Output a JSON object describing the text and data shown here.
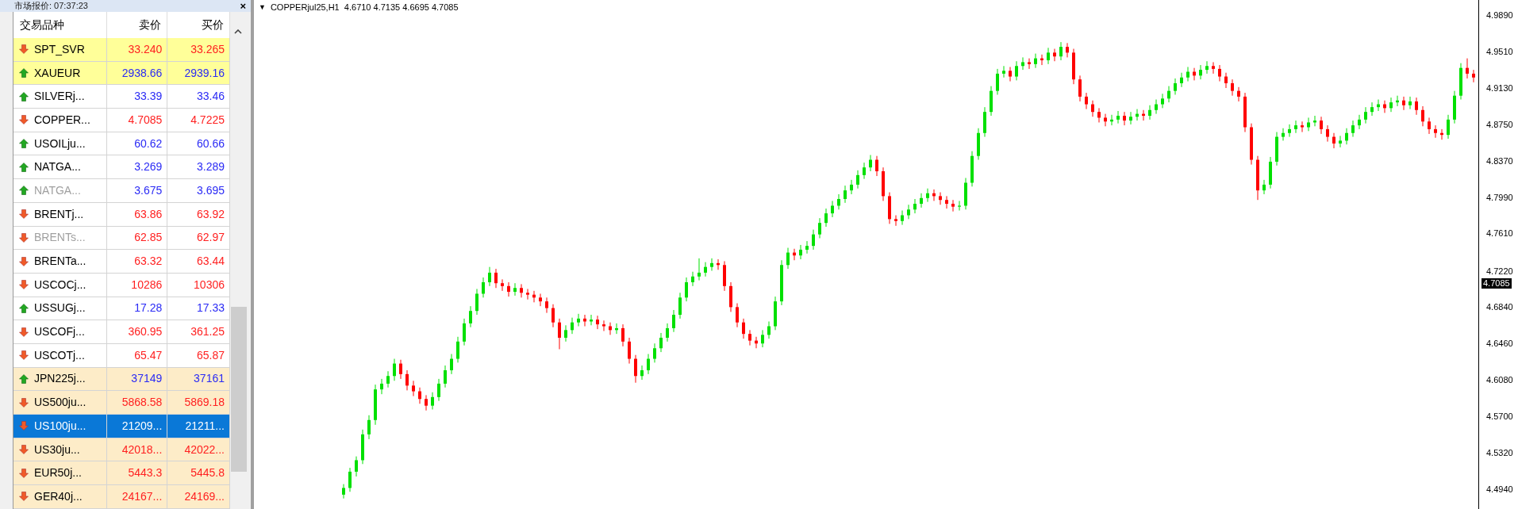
{
  "market_watch": {
    "title": "市场报价: 07:37:23",
    "close_icon": "×",
    "columns": [
      "交易品种",
      "卖价",
      "买价"
    ],
    "rows": [
      {
        "symbol": "SPT_SVR",
        "bid": "33.240",
        "ask": "33.265",
        "rising": false,
        "kind": "spot",
        "disabled": false,
        "selected": false
      },
      {
        "symbol": "XAUEUR",
        "bid": "2938.66",
        "ask": "2939.16",
        "rising": true,
        "kind": "spot",
        "disabled": false,
        "selected": false
      },
      {
        "symbol": "SILVERj...",
        "bid": "33.39",
        "ask": "33.46",
        "rising": true,
        "kind": "futures",
        "disabled": false,
        "selected": false
      },
      {
        "symbol": "COPPER...",
        "bid": "4.7085",
        "ask": "4.7225",
        "rising": false,
        "kind": "futures",
        "disabled": false,
        "selected": false
      },
      {
        "symbol": "USOILju...",
        "bid": "60.62",
        "ask": "60.66",
        "rising": true,
        "kind": "futures",
        "disabled": false,
        "selected": false
      },
      {
        "symbol": "NATGA...",
        "bid": "3.269",
        "ask": "3.289",
        "rising": true,
        "kind": "futures",
        "disabled": false,
        "selected": false
      },
      {
        "symbol": "NATGA...",
        "bid": "3.675",
        "ask": "3.695",
        "rising": true,
        "kind": "futures",
        "disabled": true,
        "selected": false
      },
      {
        "symbol": "BRENTj...",
        "bid": "63.86",
        "ask": "63.92",
        "rising": false,
        "kind": "futures",
        "disabled": false,
        "selected": false
      },
      {
        "symbol": "BRENTs...",
        "bid": "62.85",
        "ask": "62.97",
        "rising": false,
        "kind": "futures",
        "disabled": true,
        "selected": false
      },
      {
        "symbol": "BRENTa...",
        "bid": "63.32",
        "ask": "63.44",
        "rising": false,
        "kind": "futures",
        "disabled": false,
        "selected": false
      },
      {
        "symbol": "USCOCj...",
        "bid": "10286",
        "ask": "10306",
        "rising": false,
        "kind": "futures",
        "disabled": false,
        "selected": false
      },
      {
        "symbol": "USSUGj...",
        "bid": "17.28",
        "ask": "17.33",
        "rising": true,
        "kind": "futures",
        "disabled": false,
        "selected": false
      },
      {
        "symbol": "USCOFj...",
        "bid": "360.95",
        "ask": "361.25",
        "rising": false,
        "kind": "futures",
        "disabled": false,
        "selected": false
      },
      {
        "symbol": "USCOTj...",
        "bid": "65.47",
        "ask": "65.87",
        "rising": false,
        "kind": "futures",
        "disabled": false,
        "selected": false
      },
      {
        "symbol": "JPN225j...",
        "bid": "37149",
        "ask": "37161",
        "rising": true,
        "kind": "index",
        "disabled": false,
        "selected": false
      },
      {
        "symbol": "US500ju...",
        "bid": "5868.58",
        "ask": "5869.18",
        "rising": false,
        "kind": "index",
        "disabled": false,
        "selected": false
      },
      {
        "symbol": "US100ju...",
        "bid": "21209...",
        "ask": "21211...",
        "rising": false,
        "selected": true
      },
      {
        "symbol": "US30ju...",
        "bid": "42018...",
        "ask": "42022...",
        "rising": false,
        "kind": "index",
        "disabled": false,
        "selected": false
      },
      {
        "symbol": "EUR50j...",
        "bid": "5443.3",
        "ask": "5445.8",
        "rising": false,
        "kind": "index",
        "disabled": false,
        "selected": false
      },
      {
        "symbol": "GER40j...",
        "bid": "24167...",
        "ask": "24169...",
        "rising": false,
        "kind": "index",
        "disabled": false,
        "selected": false
      }
    ]
  },
  "chart": {
    "collapse_glyph": "▼",
    "header": "COPPERjul25,H1  4.6710 4.7135 4.6695 4.7085",
    "current_price": "4.7085",
    "chart_data": {
      "type": "candlestick",
      "ylim": [
        4.473,
        5.005
      ],
      "yticks": [
        {
          "value": 4.989,
          "label": "4.9890"
        },
        {
          "value": 4.951,
          "label": "4.9510"
        },
        {
          "value": 4.913,
          "label": "4.9130"
        },
        {
          "value": 4.875,
          "label": "4.8750"
        },
        {
          "value": 4.837,
          "label": "4.8370"
        },
        {
          "value": 4.799,
          "label": "4.7990"
        },
        {
          "value": 4.761,
          "label": "4.7610"
        },
        {
          "value": 4.722,
          "label": "4.7220"
        },
        {
          "value": 4.684,
          "label": "4.6840"
        },
        {
          "value": 4.646,
          "label": "4.6460"
        },
        {
          "value": 4.608,
          "label": "4.6080"
        },
        {
          "value": 4.57,
          "label": "4.5700"
        },
        {
          "value": 4.532,
          "label": "4.5320"
        },
        {
          "value": 4.494,
          "label": "4.4940"
        }
      ],
      "ohlc": [
        [
          4.488,
          4.499,
          4.484,
          4.495
        ],
        [
          4.495,
          4.516,
          4.491,
          4.512
        ],
        [
          4.512,
          4.528,
          4.507,
          4.524
        ],
        [
          4.524,
          4.556,
          4.52,
          4.551
        ],
        [
          4.551,
          4.571,
          4.546,
          4.566
        ],
        [
          4.566,
          4.603,
          4.561,
          4.598
        ],
        [
          4.598,
          4.609,
          4.593,
          4.604
        ],
        [
          4.604,
          4.617,
          4.6,
          4.612
        ],
        [
          4.612,
          4.63,
          4.607,
          4.625
        ],
        [
          4.625,
          4.629,
          4.609,
          4.614
        ],
        [
          4.614,
          4.618,
          4.597,
          4.602
        ],
        [
          4.602,
          4.607,
          4.591,
          4.596
        ],
        [
          4.596,
          4.6,
          4.583,
          4.588
        ],
        [
          4.588,
          4.592,
          4.576,
          4.581
        ],
        [
          4.581,
          4.595,
          4.577,
          4.59
        ],
        [
          4.59,
          4.609,
          4.586,
          4.604
        ],
        [
          4.604,
          4.623,
          4.6,
          4.618
        ],
        [
          4.618,
          4.635,
          4.614,
          4.63
        ],
        [
          4.63,
          4.653,
          4.626,
          4.648
        ],
        [
          4.648,
          4.672,
          4.644,
          4.667
        ],
        [
          4.667,
          4.685,
          4.663,
          4.68
        ],
        [
          4.68,
          4.703,
          4.676,
          4.698
        ],
        [
          4.698,
          4.715,
          4.694,
          4.71
        ],
        [
          4.71,
          4.726,
          4.706,
          4.72
        ],
        [
          4.72,
          4.724,
          4.704,
          4.709
        ],
        [
          4.709,
          4.713,
          4.701,
          4.706
        ],
        [
          4.706,
          4.71,
          4.695,
          4.7
        ],
        [
          4.7,
          4.709,
          4.696,
          4.704
        ],
        [
          4.704,
          4.708,
          4.694,
          4.699
        ],
        [
          4.699,
          4.703,
          4.692,
          4.697
        ],
        [
          4.697,
          4.701,
          4.689,
          4.694
        ],
        [
          4.694,
          4.698,
          4.685,
          4.69
        ],
        [
          4.69,
          4.694,
          4.678,
          4.683
        ],
        [
          4.683,
          4.687,
          4.663,
          4.668
        ],
        [
          4.668,
          4.672,
          4.64,
          4.652
        ],
        [
          4.652,
          4.665,
          4.648,
          4.66
        ],
        [
          4.66,
          4.673,
          4.656,
          4.668
        ],
        [
          4.668,
          4.677,
          4.664,
          4.672
        ],
        [
          4.672,
          4.676,
          4.664,
          4.669
        ],
        [
          4.669,
          4.676,
          4.665,
          4.671
        ],
        [
          4.671,
          4.675,
          4.661,
          4.666
        ],
        [
          4.666,
          4.67,
          4.659,
          4.664
        ],
        [
          4.664,
          4.668,
          4.655,
          4.66
        ],
        [
          4.66,
          4.667,
          4.656,
          4.662
        ],
        [
          4.662,
          4.666,
          4.643,
          4.648
        ],
        [
          4.648,
          4.652,
          4.625,
          4.63
        ],
        [
          4.63,
          4.634,
          4.605,
          4.612
        ],
        [
          4.612,
          4.623,
          4.608,
          4.618
        ],
        [
          4.618,
          4.635,
          4.614,
          4.63
        ],
        [
          4.63,
          4.646,
          4.626,
          4.641
        ],
        [
          4.641,
          4.657,
          4.637,
          4.652
        ],
        [
          4.652,
          4.667,
          4.648,
          4.662
        ],
        [
          4.662,
          4.681,
          4.658,
          4.676
        ],
        [
          4.676,
          4.699,
          4.672,
          4.694
        ],
        [
          4.694,
          4.715,
          4.69,
          4.71
        ],
        [
          4.71,
          4.721,
          4.706,
          4.716
        ],
        [
          4.716,
          4.735,
          4.712,
          4.72
        ],
        [
          4.72,
          4.731,
          4.716,
          4.726
        ],
        [
          4.726,
          4.735,
          4.722,
          4.73
        ],
        [
          4.73,
          4.734,
          4.723,
          4.728
        ],
        [
          4.728,
          4.732,
          4.701,
          4.706
        ],
        [
          4.706,
          4.71,
          4.679,
          4.684
        ],
        [
          4.684,
          4.688,
          4.663,
          4.668
        ],
        [
          4.668,
          4.672,
          4.651,
          4.656
        ],
        [
          4.656,
          4.66,
          4.644,
          4.649
        ],
        [
          4.649,
          4.653,
          4.641,
          4.646
        ],
        [
          4.646,
          4.66,
          4.642,
          4.655
        ],
        [
          4.655,
          4.669,
          4.651,
          4.664
        ],
        [
          4.664,
          4.695,
          4.66,
          4.69
        ],
        [
          4.69,
          4.733,
          4.686,
          4.728
        ],
        [
          4.728,
          4.746,
          4.724,
          4.741
        ],
        [
          4.741,
          4.745,
          4.733,
          4.738
        ],
        [
          4.738,
          4.749,
          4.734,
          4.744
        ],
        [
          4.744,
          4.753,
          4.74,
          4.748
        ],
        [
          4.748,
          4.765,
          4.744,
          4.76
        ],
        [
          4.76,
          4.777,
          4.756,
          4.772
        ],
        [
          4.772,
          4.787,
          4.768,
          4.782
        ],
        [
          4.782,
          4.795,
          4.778,
          4.79
        ],
        [
          4.79,
          4.802,
          4.786,
          4.797
        ],
        [
          4.797,
          4.811,
          4.793,
          4.806
        ],
        [
          4.806,
          4.817,
          4.802,
          4.812
        ],
        [
          4.812,
          4.827,
          4.808,
          4.822
        ],
        [
          4.822,
          4.835,
          4.818,
          4.83
        ],
        [
          4.83,
          4.843,
          4.826,
          4.838
        ],
        [
          4.838,
          4.842,
          4.821,
          4.826
        ],
        [
          4.826,
          4.83,
          4.795,
          4.8
        ],
        [
          4.8,
          4.804,
          4.771,
          4.776
        ],
        [
          4.776,
          4.78,
          4.769,
          4.774
        ],
        [
          4.774,
          4.785,
          4.77,
          4.78
        ],
        [
          4.78,
          4.791,
          4.776,
          4.786
        ],
        [
          4.786,
          4.797,
          4.782,
          4.792
        ],
        [
          4.792,
          4.803,
          4.788,
          4.798
        ],
        [
          4.798,
          4.808,
          4.794,
          4.803
        ],
        [
          4.803,
          4.807,
          4.795,
          4.8
        ],
        [
          4.8,
          4.804,
          4.791,
          4.796
        ],
        [
          4.796,
          4.8,
          4.787,
          4.792
        ],
        [
          4.792,
          4.796,
          4.784,
          4.789
        ],
        [
          4.789,
          4.795,
          4.785,
          4.79
        ],
        [
          4.79,
          4.819,
          4.786,
          4.814
        ],
        [
          4.814,
          4.847,
          4.81,
          4.842
        ],
        [
          4.842,
          4.871,
          4.838,
          4.866
        ],
        [
          4.866,
          4.893,
          4.862,
          4.888
        ],
        [
          4.888,
          4.915,
          4.884,
          4.91
        ],
        [
          4.91,
          4.933,
          4.906,
          4.928
        ],
        [
          4.928,
          4.936,
          4.924,
          4.931
        ],
        [
          4.931,
          4.935,
          4.92,
          4.925
        ],
        [
          4.925,
          4.941,
          4.921,
          4.936
        ],
        [
          4.936,
          4.945,
          4.932,
          4.94
        ],
        [
          4.94,
          4.944,
          4.933,
          4.938
        ],
        [
          4.938,
          4.949,
          4.934,
          4.944
        ],
        [
          4.944,
          4.948,
          4.937,
          4.942
        ],
        [
          4.942,
          4.955,
          4.938,
          4.95
        ],
        [
          4.95,
          4.954,
          4.941,
          4.946
        ],
        [
          4.946,
          4.961,
          4.942,
          4.956
        ],
        [
          4.956,
          4.96,
          4.945,
          4.95
        ],
        [
          4.95,
          4.954,
          4.917,
          4.922
        ],
        [
          4.922,
          4.926,
          4.899,
          4.904
        ],
        [
          4.904,
          4.908,
          4.891,
          4.896
        ],
        [
          4.896,
          4.9,
          4.883,
          4.888
        ],
        [
          4.888,
          4.892,
          4.877,
          4.882
        ],
        [
          4.882,
          4.886,
          4.873,
          4.878
        ],
        [
          4.878,
          4.885,
          4.874,
          4.88
        ],
        [
          4.88,
          4.889,
          4.876,
          4.884
        ],
        [
          4.884,
          4.888,
          4.874,
          4.879
        ],
        [
          4.879,
          4.888,
          4.875,
          4.883
        ],
        [
          4.883,
          4.891,
          4.879,
          4.886
        ],
        [
          4.886,
          4.89,
          4.879,
          4.884
        ],
        [
          4.884,
          4.895,
          4.88,
          4.89
        ],
        [
          4.89,
          4.901,
          4.886,
          4.896
        ],
        [
          4.896,
          4.907,
          4.892,
          4.902
        ],
        [
          4.902,
          4.915,
          4.898,
          4.91
        ],
        [
          4.91,
          4.923,
          4.906,
          4.918
        ],
        [
          4.918,
          4.929,
          4.914,
          4.924
        ],
        [
          4.924,
          4.935,
          4.92,
          4.93
        ],
        [
          4.93,
          4.934,
          4.921,
          4.926
        ],
        [
          4.926,
          4.937,
          4.922,
          4.932
        ],
        [
          4.932,
          4.941,
          4.928,
          4.936
        ],
        [
          4.936,
          4.94,
          4.928,
          4.933
        ],
        [
          4.933,
          4.937,
          4.92,
          4.925
        ],
        [
          4.925,
          4.929,
          4.913,
          4.918
        ],
        [
          4.918,
          4.922,
          4.905,
          4.91
        ],
        [
          4.91,
          4.914,
          4.899,
          4.904
        ],
        [
          4.904,
          4.908,
          4.867,
          4.872
        ],
        [
          4.872,
          4.876,
          4.833,
          4.838
        ],
        [
          4.838,
          4.842,
          4.796,
          4.806
        ],
        [
          4.806,
          4.817,
          4.802,
          4.812
        ],
        [
          4.812,
          4.841,
          4.808,
          4.836
        ],
        [
          4.836,
          4.867,
          4.832,
          4.862
        ],
        [
          4.862,
          4.871,
          4.858,
          4.866
        ],
        [
          4.866,
          4.875,
          4.862,
          4.87
        ],
        [
          4.87,
          4.879,
          4.866,
          4.874
        ],
        [
          4.874,
          4.878,
          4.867,
          4.872
        ],
        [
          4.872,
          4.882,
          4.868,
          4.877
        ],
        [
          4.877,
          4.884,
          4.873,
          4.879
        ],
        [
          4.879,
          4.883,
          4.865,
          4.87
        ],
        [
          4.87,
          4.874,
          4.857,
          4.862
        ],
        [
          4.862,
          4.866,
          4.85,
          4.855
        ],
        [
          4.855,
          4.863,
          4.851,
          4.858
        ],
        [
          4.858,
          4.871,
          4.854,
          4.866
        ],
        [
          4.866,
          4.879,
          4.862,
          4.874
        ],
        [
          4.874,
          4.885,
          4.87,
          4.88
        ],
        [
          4.88,
          4.893,
          4.876,
          4.888
        ],
        [
          4.888,
          4.898,
          4.884,
          4.893
        ],
        [
          4.893,
          4.901,
          4.889,
          4.896
        ],
        [
          4.896,
          4.9,
          4.887,
          4.892
        ],
        [
          4.892,
          4.903,
          4.888,
          4.898
        ],
        [
          4.898,
          4.905,
          4.894,
          4.9
        ],
        [
          4.9,
          4.904,
          4.89,
          4.895
        ],
        [
          4.895,
          4.904,
          4.891,
          4.899
        ],
        [
          4.899,
          4.903,
          4.885,
          4.89
        ],
        [
          4.89,
          4.894,
          4.873,
          4.878
        ],
        [
          4.878,
          4.882,
          4.865,
          4.87
        ],
        [
          4.87,
          4.874,
          4.861,
          4.866
        ],
        [
          4.866,
          4.87,
          4.859,
          4.864
        ],
        [
          4.864,
          4.885,
          4.86,
          4.88
        ],
        [
          4.88,
          4.91,
          4.876,
          4.905
        ],
        [
          4.905,
          4.939,
          4.901,
          4.934
        ],
        [
          4.934,
          4.944,
          4.923,
          4.928
        ],
        [
          4.928,
          4.932,
          4.919,
          4.924
        ]
      ]
    }
  }
}
